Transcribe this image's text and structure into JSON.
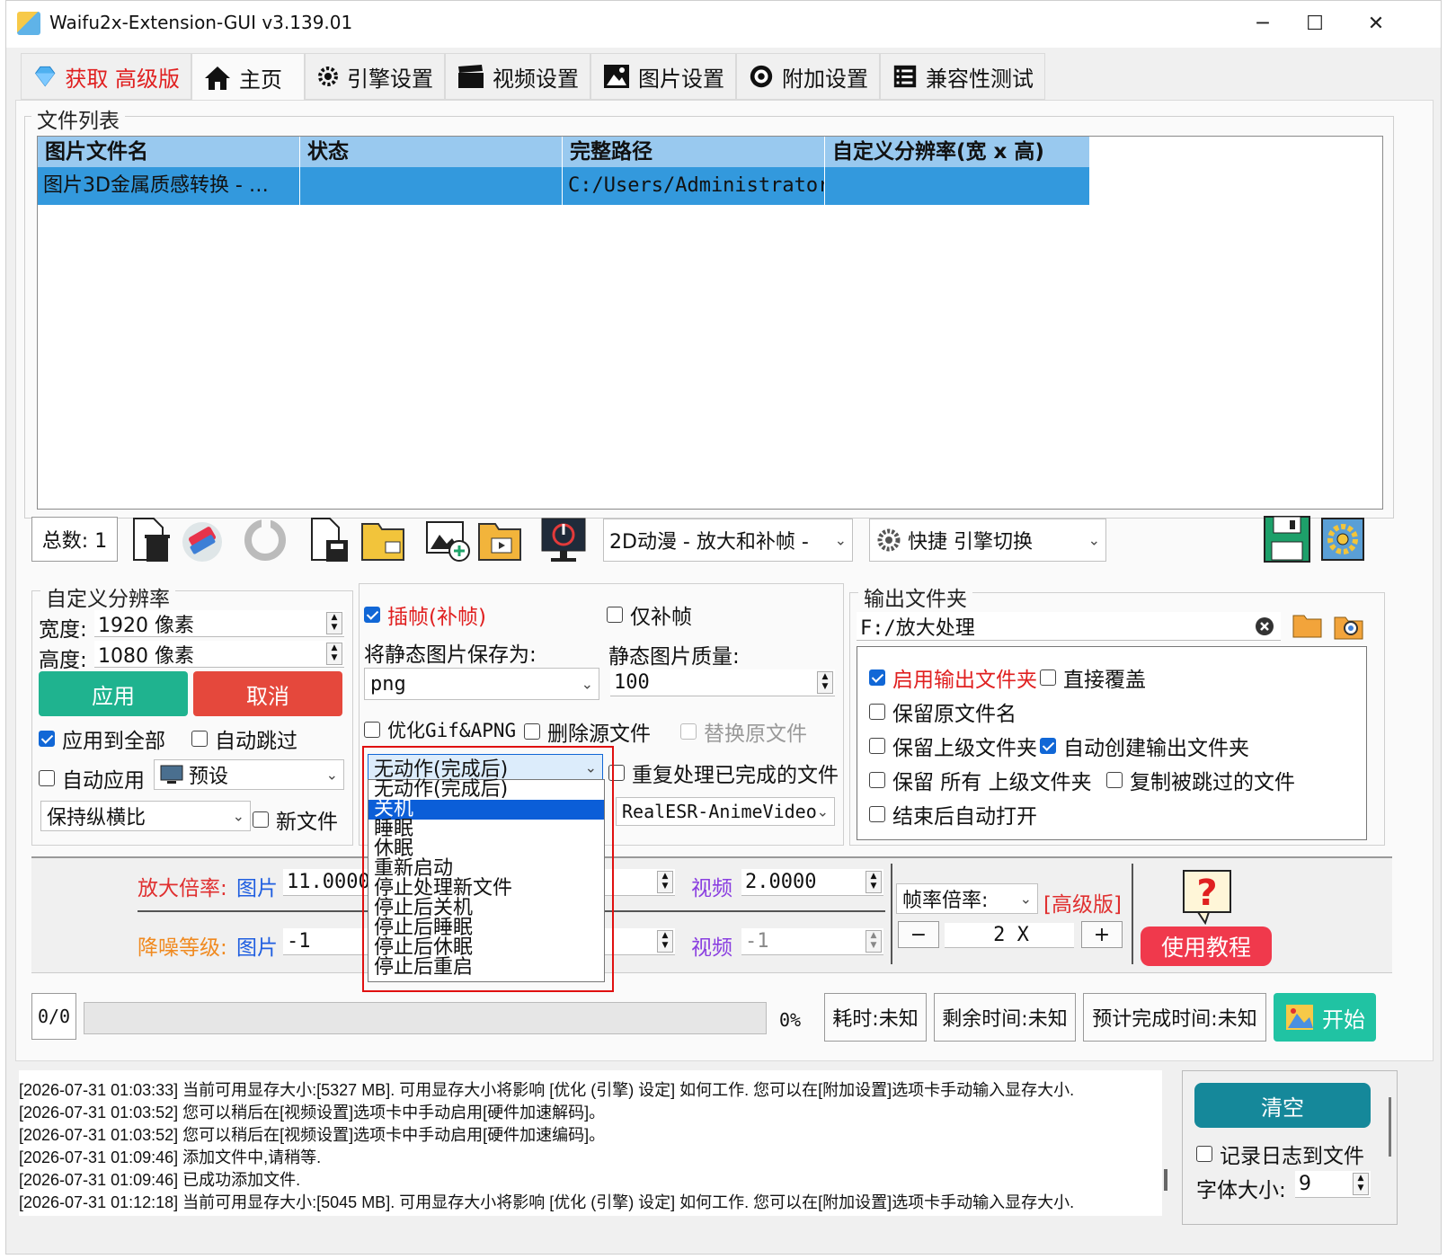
{
  "window": {
    "title": "Waifu2x-Extension-GUI v3.139.01"
  },
  "tabs": [
    {
      "label": "获取 高级版"
    },
    {
      "label": "主页"
    },
    {
      "label": "引擎设置"
    },
    {
      "label": "视频设置"
    },
    {
      "label": "图片设置"
    },
    {
      "label": "附加设置"
    },
    {
      "label": "兼容性测试"
    }
  ],
  "file_list": {
    "group_label": "文件列表",
    "columns": [
      "图片文件名",
      "状态",
      "完整路径",
      "自定义分辨率(宽 x 高)"
    ],
    "rows": [
      {
        "name": "图片3D金属质感转换 - …",
        "status": "",
        "path": "C:/Users/Administrator…",
        "resolution": ""
      }
    ]
  },
  "toolbar": {
    "total": "总数: 1",
    "mode_combo": "2D动漫 - 放大和补帧 -",
    "engine_combo": "快捷 引擎切换"
  },
  "custom_res": {
    "group_label": "自定义分辨率",
    "width_label": "宽度:",
    "width_value": "1920 像素",
    "height_label": "高度:",
    "height_value": "1080 像素",
    "apply": "应用",
    "cancel": "取消",
    "apply_all": "应用到全部",
    "auto_skip": "自动跳过",
    "auto_apply": "自动应用",
    "preset": "预设",
    "aspect": "保持纵横比",
    "new_file": "新文件"
  },
  "middle": {
    "interp": "插帧(补帧)",
    "interp_only": "仅补帧",
    "save_as_label": "将静态图片保存为:",
    "quality_label": "静态图片质量:",
    "format": "png",
    "quality": "100",
    "opt_gif": "优化Gif&APNG",
    "delete_src": "删除源文件",
    "replace_src": "替换原文件",
    "after_action": "无动作(完成后)",
    "reprocess": "重复处理已完成的文件",
    "model": "RealESR-AnimeVideo"
  },
  "dropdown": {
    "items": [
      "无动作(完成后)",
      "关机",
      "睡眠",
      "休眠",
      "重新启动",
      "停止处理新文件",
      "停止后关机",
      "停止后睡眠",
      "停止后休眠",
      "停止后重启"
    ],
    "selected_index": 1
  },
  "output": {
    "group_label": "输出文件夹",
    "path": "F:/放大处理",
    "enable": "启用输出文件夹",
    "overwrite": "直接覆盖",
    "keep_name": "保留原文件名",
    "keep_parent": "保留上级文件夹",
    "auto_create": "自动创建输出文件夹",
    "keep_all_parent": "保留 所有 上级文件夹",
    "copy_skipped": "复制被跳过的文件",
    "open_after": "结束后自动打开"
  },
  "scale": {
    "scale_label": "放大倍率:",
    "img_label": "图片",
    "img_value": "11.0000",
    "video_label": "视频",
    "video_value": "2.0000",
    "denoise_label": "降噪等级:",
    "denoise_img": "-1",
    "denoise_video": "-1",
    "fps_label": "帧率倍率:",
    "pro_label": "[高级版]",
    "fps_value": "2 X",
    "minus": "−",
    "plus": "+",
    "tutorial": "使用教程"
  },
  "progress": {
    "count": "0/0",
    "percent": "0%",
    "percent_value": 0,
    "elapsed": "耗时:未知",
    "remaining": "剩余时间:未知",
    "eta": "预计完成时间:未知",
    "start": "开始"
  },
  "log": {
    "lines": [
      "[2026-07-31 01:03:33] 当前可用显存大小:[5327 MB]. 可用显存大小将影响 [优化 (引擎) 设定] 如何工作. 您可以在[附加设置]选项卡手动输入显存大小.",
      "[2026-07-31 01:03:52] 您可以稍后在[视频设置]选项卡中手动启用[硬件加速解码]。",
      "[2026-07-31 01:03:52] 您可以稍后在[视频设置]选项卡中手动启用[硬件加速编码]。",
      "[2026-07-31 01:09:46] 添加文件中,请稍等.",
      "[2026-07-31 01:09:46] 已成功添加文件.",
      "[2026-07-31 01:12:18] 当前可用显存大小:[5045 MB]. 可用显存大小将影响 [优化 (引擎) 设定] 如何工作. 您可以在[附加设置]选项卡手动输入显存大小."
    ],
    "clear": "清空",
    "log_to_file": "记录日志到文件",
    "font_size_label": "字体大小:",
    "font_size_value": "9"
  },
  "colors": {
    "accent_teal": "#1fb38f",
    "cancel_red": "#e5483c",
    "tutorial_red": "#f0394c",
    "clear_teal": "#15889a",
    "start_teal": "#20c3a3",
    "header_blue": "#99c9ef",
    "row_blue": "#3399dd"
  }
}
